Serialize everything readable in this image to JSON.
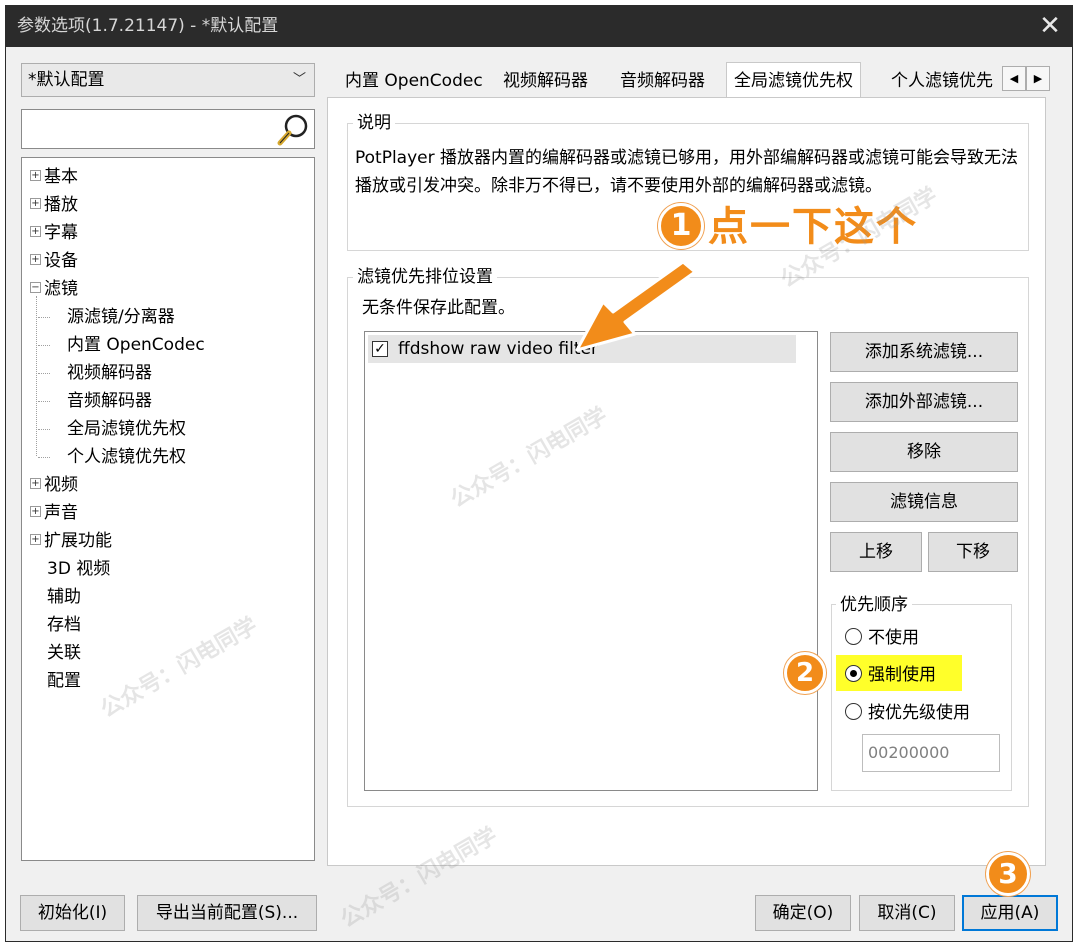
{
  "window": {
    "title": "参数选项(1.7.21147) - *默认配置",
    "close_glyph": "✕"
  },
  "sidebar": {
    "profile_select": "*默认配置",
    "search_value": "",
    "tree": [
      {
        "label": "基本",
        "expander": "+"
      },
      {
        "label": "播放",
        "expander": "+"
      },
      {
        "label": "字幕",
        "expander": "+"
      },
      {
        "label": "设备",
        "expander": "+"
      },
      {
        "label": "滤镜",
        "expander": "−"
      },
      {
        "label": "源滤镜/分离器",
        "child": true
      },
      {
        "label": "内置 OpenCodec",
        "child": true
      },
      {
        "label": "视频解码器",
        "child": true
      },
      {
        "label": "音频解码器",
        "child": true
      },
      {
        "label": "全局滤镜优先权",
        "child": true
      },
      {
        "label": "个人滤镜优先权",
        "child": true
      },
      {
        "label": "视频",
        "expander": "+"
      },
      {
        "label": "声音",
        "expander": "+"
      },
      {
        "label": "扩展功能",
        "expander": "+"
      },
      {
        "label": "3D 视频"
      },
      {
        "label": "辅助"
      },
      {
        "label": "存档"
      },
      {
        "label": "关联"
      },
      {
        "label": "配置"
      }
    ]
  },
  "tabs": {
    "items": [
      "内置 OpenCodec",
      "视频解码器",
      "音频解码器",
      "全局滤镜优先权",
      "个人滤镜优先"
    ],
    "active_index": 3,
    "scroll_left": "◀",
    "scroll_right": "▶"
  },
  "description": {
    "title": "说明",
    "text": "PotPlayer 播放器内置的编解码器或滤镜已够用，用外部编解码器或滤镜可能会导致无法播放或引发冲突。除非万不得已，请不要使用外部的编解码器或滤镜。"
  },
  "filter_priority": {
    "title": "滤镜优先排位设置",
    "note": "无条件保存此配置。",
    "filters": [
      {
        "name": "ffdshow raw video filter",
        "checked": true
      }
    ],
    "check_glyph": "✓",
    "buttons": {
      "add_system": "添加系统滤镜...",
      "add_external": "添加外部滤镜...",
      "remove": "移除",
      "info": "滤镜信息",
      "move_up": "上移",
      "move_down": "下移"
    },
    "priority": {
      "title": "优先顺序",
      "options": [
        "不使用",
        "强制使用",
        "按优先级使用"
      ],
      "selected_index": 1,
      "merit_value": "00200000"
    }
  },
  "footer": {
    "reset": "初始化(I)",
    "export": "导出当前配置(S)...",
    "ok": "确定(O)",
    "cancel": "取消(C)",
    "apply": "应用(A)"
  },
  "annotations": {
    "step1_number": "1",
    "step1_text": "点一下这个",
    "step2_number": "2",
    "step3_number": "3",
    "accent_color": "#f28c1a",
    "highlight_color": "#ffff2a"
  },
  "watermark": {
    "text": "公众号：闪电同学"
  }
}
